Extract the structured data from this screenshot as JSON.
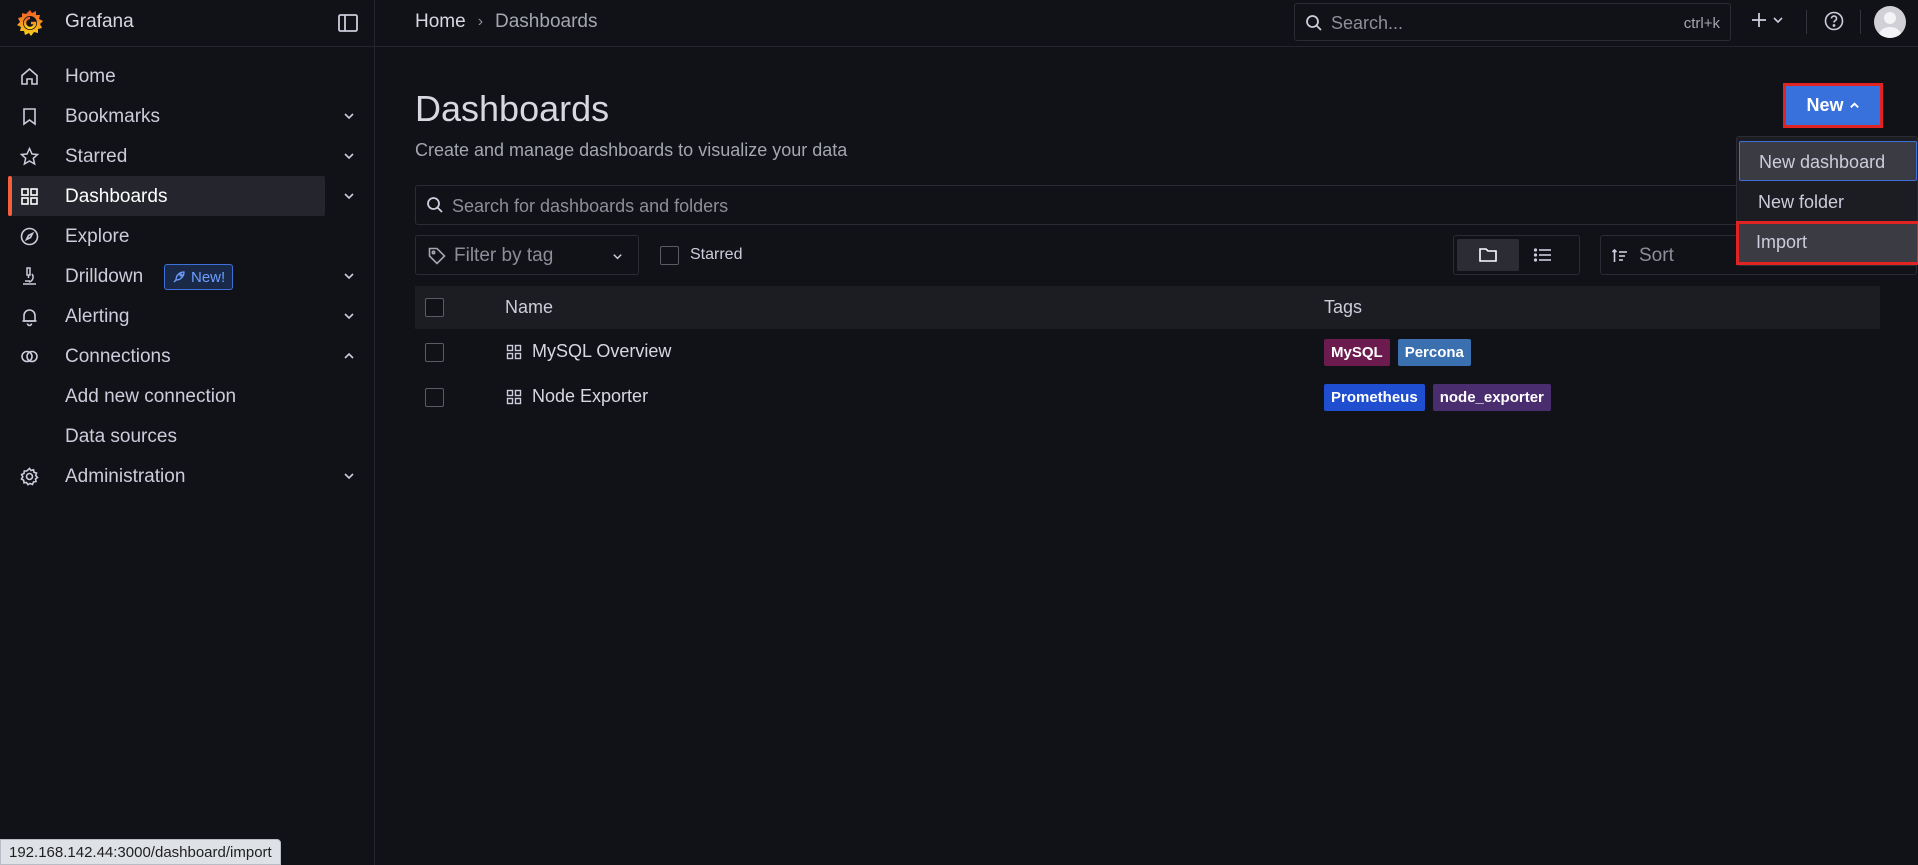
{
  "app": {
    "name": "Grafana"
  },
  "breadcrumb": {
    "home": "Home",
    "current": "Dashboards"
  },
  "top_search": {
    "placeholder": "Search...",
    "shortcut": "ctrl+k"
  },
  "sidebar": {
    "items": [
      {
        "label": "Home",
        "icon": "home-icon"
      },
      {
        "label": "Bookmarks",
        "icon": "bookmark-icon"
      },
      {
        "label": "Starred",
        "icon": "star-icon"
      },
      {
        "label": "Dashboards",
        "icon": "dashboards-grid-icon",
        "active": true
      },
      {
        "label": "Explore",
        "icon": "compass-icon"
      },
      {
        "label": "Drilldown",
        "icon": "microscope-icon",
        "badge": "New!"
      },
      {
        "label": "Alerting",
        "icon": "bell-icon"
      },
      {
        "label": "Connections",
        "icon": "connections-icon",
        "expanded": true
      },
      {
        "label": "Add new connection"
      },
      {
        "label": "Data sources"
      },
      {
        "label": "Administration",
        "icon": "gear-icon"
      }
    ]
  },
  "page": {
    "title": "Dashboards",
    "subtitle": "Create and manage dashboards to visualize your data",
    "new_button": "New"
  },
  "dash_search": {
    "placeholder": "Search for dashboards and folders"
  },
  "filters": {
    "tag_placeholder": "Filter by tag",
    "starred_label": "Starred",
    "sort_placeholder": "Sort"
  },
  "table": {
    "headers": {
      "name": "Name",
      "tags": "Tags"
    },
    "rows": [
      {
        "name": "MySQL Overview",
        "tags": [
          {
            "label": "MySQL",
            "color": "#6b1b4e"
          },
          {
            "label": "Percona",
            "color": "#3a6fb0"
          }
        ]
      },
      {
        "name": "Node Exporter",
        "tags": [
          {
            "label": "Prometheus",
            "color": "#1f4fd0"
          },
          {
            "label": "node_exporter",
            "color": "#4a2d6e"
          }
        ]
      }
    ]
  },
  "new_menu": {
    "items": [
      "New dashboard",
      "New folder",
      "Import"
    ]
  },
  "status_bar": {
    "url": "192.168.142.44:3000/dashboard/import"
  },
  "colors": {
    "accent": "#f55f3e",
    "primary": "#3871dc",
    "highlight_border": "#e02323",
    "background": "#111217"
  }
}
